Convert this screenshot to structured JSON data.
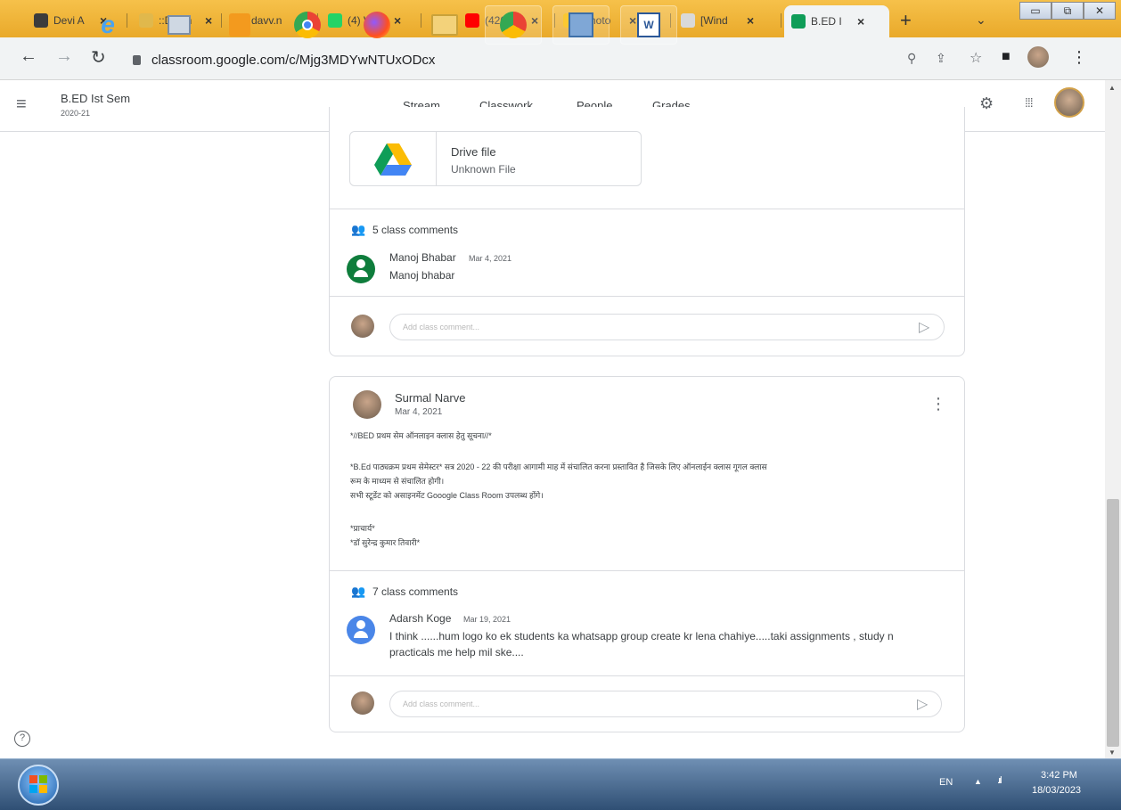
{
  "browser": {
    "tabs": [
      {
        "title": "Devi A",
        "fav_color": "#3c3c3c"
      },
      {
        "title": "::Down",
        "fav_color": "#e0b84c"
      },
      {
        "title": "davv.n",
        "fav_color": "#e0b84c"
      },
      {
        "title": "(4) Wh",
        "fav_color": "#25d366"
      },
      {
        "title": "(4200)",
        "fav_color": "#ff0000"
      },
      {
        "title": "Photo",
        "fav_color": "#fbbc04"
      },
      {
        "title": "[Wind",
        "fav_color": "#d9d9d9"
      },
      {
        "title": "B.ED I",
        "fav_color": "#0f9d58",
        "active": true
      }
    ],
    "new_tab": "+",
    "address": "classroom.google.com/c/Mjg3MDYwNTUxODcx"
  },
  "header": {
    "class_name": "B.ED Ist Sem",
    "class_section": "2020-21",
    "nav": [
      "Stream",
      "Classwork",
      "People",
      "Grades"
    ]
  },
  "post1": {
    "attachment_title": "Drive file",
    "attachment_sub": "Unknown File",
    "comment_count": "5 class comments",
    "comment_author": "Manoj Bhabar",
    "comment_date": "Mar 4, 2021",
    "comment_text": "Manoj bhabar",
    "input_placeholder": "Add class comment..."
  },
  "post2": {
    "author": "Surmal Narve",
    "date": "Mar 4, 2021",
    "line1": "*//BED प्रथम सेम ऑनलाइन क्लास हेतु सूचना//*",
    "line2": "*B.Ed पाठ्यक्रम प्रथम सेमेस्टर* सत्र 2020 - 22 की परीक्षा आगामी माह में संचालित करना प्रस्तावित है जिसके लिए ऑनलाईन क्लास गूगल क्लास",
    "line3": "रूम के माध्यम से संचालित होगी।",
    "line4": "सभी स्टूडेंट को असाइनमेंट Gooogle Class Room उपलब्ध होंगे।",
    "line5": "*प्राचार्य*",
    "line6": "*डॉ सुरेन्द्र कुमार तिवारी*",
    "comment_count": "7 class comments",
    "comment_author": "Adarsh Koge",
    "comment_date": "Mar 19, 2021",
    "comment_line1": "I think ......hum logo ko ek students ka whatsapp group create kr lena chahiye.....taki assignments , study n",
    "comment_line2": "practicals me help mil ske....",
    "input_placeholder": "Add class comment..."
  },
  "taskbar": {
    "lang": "EN",
    "time": "3:42 PM",
    "date": "18/03/2023"
  }
}
